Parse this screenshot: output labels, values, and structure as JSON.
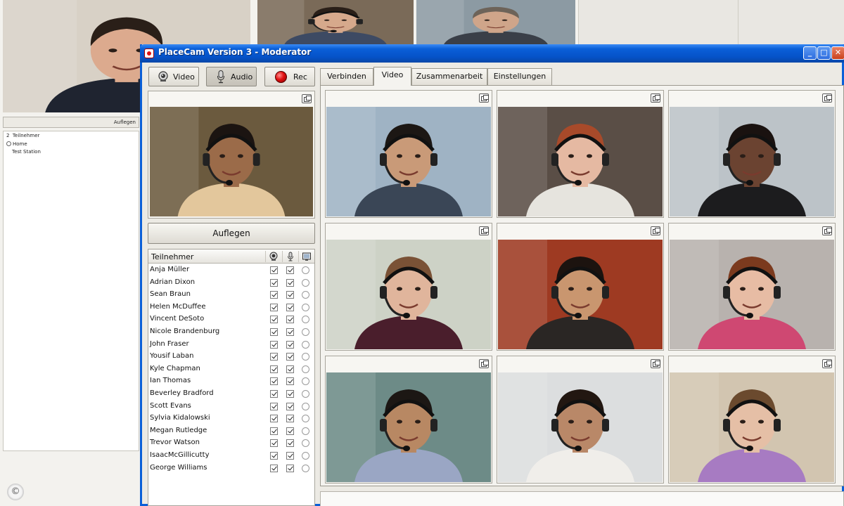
{
  "background_window": {
    "hangup_label": "Auflegen",
    "participant_count": "2",
    "participants_header": "Teilnehmer",
    "tree": [
      "Home",
      "Test Station"
    ]
  },
  "window": {
    "title": "PlaceCam Version 3 - Moderator",
    "controls": {
      "minimize": "_",
      "maximize": "□",
      "close": "✕"
    }
  },
  "toolbar": {
    "video_label": "Video",
    "audio_label": "Audio",
    "rec_label": "Rec"
  },
  "tabs": [
    {
      "label": "Verbinden",
      "active": false
    },
    {
      "label": "Video",
      "active": true
    },
    {
      "label": "Zusammenarbeit",
      "active": false
    },
    {
      "label": "Einstellungen",
      "active": false
    }
  ],
  "self_view": {
    "hangup_label": "Auflegen"
  },
  "participants": {
    "header": "Teilnehmer",
    "column_icons": [
      "camera-icon",
      "microphone-icon",
      "screen-icon"
    ],
    "rows": [
      {
        "name": "Anja Müller",
        "video": true,
        "audio": true,
        "presenter": false
      },
      {
        "name": "Adrian Dixon",
        "video": true,
        "audio": true,
        "presenter": false
      },
      {
        "name": "Sean Braun",
        "video": true,
        "audio": true,
        "presenter": false
      },
      {
        "name": "Helen McDuffee",
        "video": true,
        "audio": true,
        "presenter": false
      },
      {
        "name": "Vincent DeSoto",
        "video": true,
        "audio": true,
        "presenter": false
      },
      {
        "name": "Nicole Brandenburg",
        "video": true,
        "audio": true,
        "presenter": false
      },
      {
        "name": "John Fraser",
        "video": true,
        "audio": true,
        "presenter": false
      },
      {
        "name": "Yousif Laban",
        "video": true,
        "audio": true,
        "presenter": false
      },
      {
        "name": "Kyle Chapman",
        "video": true,
        "audio": true,
        "presenter": false
      },
      {
        "name": "Ian Thomas",
        "video": true,
        "audio": true,
        "presenter": false
      },
      {
        "name": "Beverley Bradford",
        "video": true,
        "audio": true,
        "presenter": false
      },
      {
        "name": "Scott Evans",
        "video": true,
        "audio": true,
        "presenter": false
      },
      {
        "name": "Sylvia Kidalowski",
        "video": true,
        "audio": true,
        "presenter": false
      },
      {
        "name": "Megan Rutledge",
        "video": true,
        "audio": true,
        "presenter": false
      },
      {
        "name": "Trevor Watson",
        "video": true,
        "audio": true,
        "presenter": false
      },
      {
        "name": "IsaacMcGillicutty",
        "video": true,
        "audio": true,
        "presenter": false
      },
      {
        "name": "George Williams",
        "video": true,
        "audio": true,
        "presenter": false
      }
    ]
  },
  "video_tiles": [
    {
      "bg": "#9fb3c4",
      "skin": "#c99a78",
      "hair": "#1c1714",
      "shirt": "#3a4656",
      "headset": true
    },
    {
      "bg": "#5a4e46",
      "skin": "#e5b9a2",
      "hair": "#a84a2a",
      "shirt": "#e6e4de",
      "headset": true
    },
    {
      "bg": "#bcc3c8",
      "skin": "#6b4331",
      "hair": "#1a1210",
      "shirt": "#1c1c1e",
      "headset": true
    },
    {
      "bg": "#cdd2c6",
      "skin": "#e0b59c",
      "hair": "#7a5236",
      "shirt": "#4a1e2c",
      "headset": true
    },
    {
      "bg": "#9e3a22",
      "skin": "#c9966f",
      "hair": "#1c130f",
      "shirt": "#2a2624",
      "headset": true
    },
    {
      "bg": "#b8b2ae",
      "skin": "#e7bca4",
      "hair": "#7b3a1e",
      "shirt": "#cf4872",
      "headset": true
    },
    {
      "bg": "#6d8b87",
      "skin": "#b88863",
      "hair": "#1c1714",
      "shirt": "#9aa6c4",
      "headset": true
    },
    {
      "bg": "#dcdedf",
      "skin": "#b98868",
      "hair": "#221711",
      "shirt": "#f0eeea",
      "headset": true
    },
    {
      "bg": "#d2c5b0",
      "skin": "#e5bfa6",
      "hair": "#6b4a2e",
      "shirt": "#a77bc2",
      "headset": true
    }
  ],
  "self_tile": {
    "bg": "#6b5a3e",
    "skin": "#9b6b49",
    "hair": "#1b1411",
    "shirt": "#e3c79c",
    "headset": true
  },
  "background_videos": [
    {
      "bg": "#d8d1c6",
      "skin": "#dcaa8e",
      "hair": "#2a1f18",
      "shirt": "#1f2430",
      "headset": false
    },
    {
      "bg": "#7a6a58",
      "skin": "#d6a98c",
      "hair": "#2a1f18",
      "shirt": "#3d4a63",
      "headset": true
    },
    {
      "bg": "#8c9aa3",
      "skin": "#cfa58a",
      "hair": "#6d6359",
      "shirt": "#3a3f48",
      "headset": false
    }
  ],
  "copyright_symbol": "©"
}
